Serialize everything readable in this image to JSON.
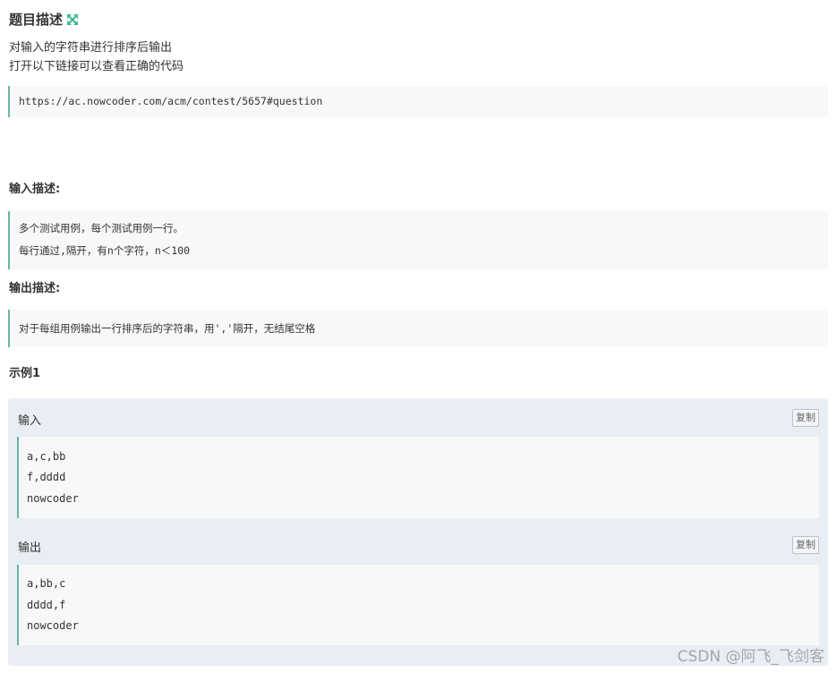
{
  "problem": {
    "title": "题目描述",
    "description_lines": [
      "对输入的字符串进行排序后输出",
      "打开以下链接可以查看正确的代码"
    ],
    "link": "https://ac.nowcoder.com/acm/contest/5657#question"
  },
  "input_desc": {
    "label": "输入描述:",
    "lines": [
      "多个测试用例，每个测试用例一行。",
      "每行通过,隔开，有n个字符，n＜100"
    ]
  },
  "output_desc": {
    "label": "输出描述:",
    "lines": [
      "对于每组用例输出一行排序后的字符串，用','隔开，无结尾空格"
    ]
  },
  "example": {
    "label": "示例1",
    "input_label": "输入",
    "output_label": "输出",
    "copy_label": "复制",
    "input_lines": [
      "a,c,bb",
      "f,dddd",
      "nowcoder"
    ],
    "output_lines": [
      "a,bb,c",
      "dddd,f",
      "nowcoder"
    ]
  },
  "watermark": "CSDN @阿飞_飞剑客",
  "colors": {
    "accent": "#6bb6a4",
    "expand_icon": "#3cb890"
  }
}
